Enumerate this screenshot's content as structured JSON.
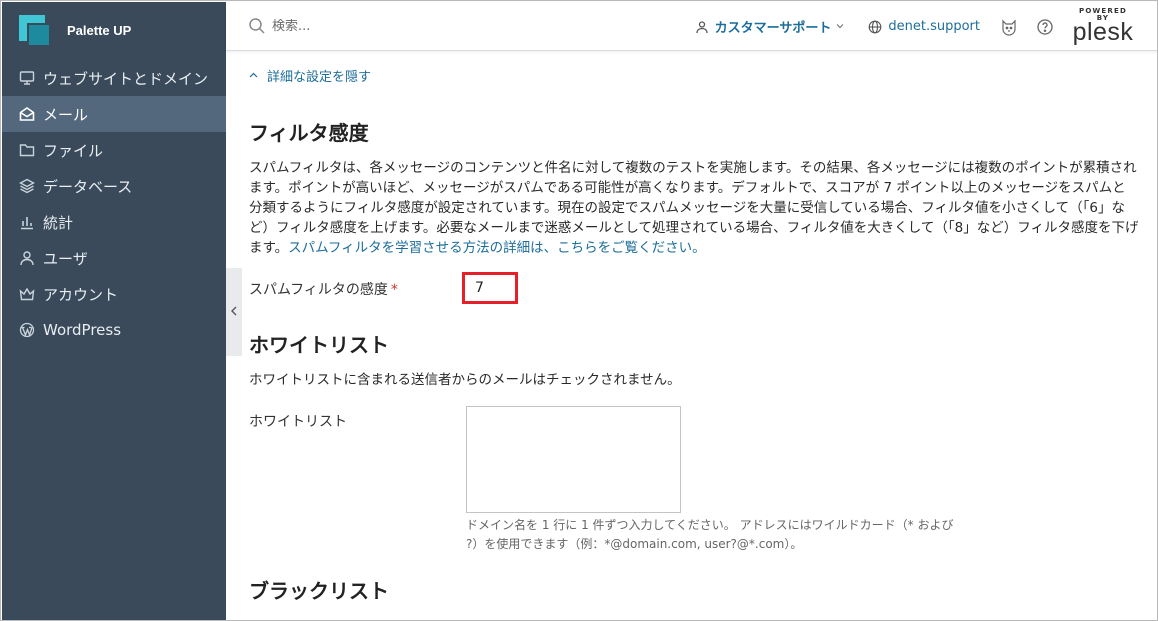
{
  "brand": {
    "name": "Palette UP"
  },
  "sidebar": {
    "items": [
      {
        "label": "ウェブサイトとドメイン",
        "icon": "monitor-icon",
        "active": false
      },
      {
        "label": "メール",
        "icon": "envelope-icon",
        "active": true
      },
      {
        "label": "ファイル",
        "icon": "folder-icon",
        "active": false
      },
      {
        "label": "データベース",
        "icon": "database-icon",
        "active": false
      },
      {
        "label": "統計",
        "icon": "bar-chart-icon",
        "active": false
      },
      {
        "label": "ユーザ",
        "icon": "user-icon",
        "active": false
      },
      {
        "label": "アカウント",
        "icon": "crown-icon",
        "active": false
      },
      {
        "label": "WordPress",
        "icon": "wordpress-icon",
        "active": false
      }
    ]
  },
  "header": {
    "search_placeholder": "検索...",
    "support_label": "カスタマーサポート",
    "domain_label": "denet.support",
    "powered_by": "POWERED BY",
    "plesk": "plesk"
  },
  "main": {
    "toggle_link": "詳細な設定を隠す",
    "filter": {
      "heading": "フィルタ感度",
      "description": "スパムフィルタは、各メッセージのコンテンツと件名に対して複数のテストを実施します。その結果、各メッセージには複数のポイントが累積されます。ポイントが高いほど、メッセージがスパムである可能性が高くなります。デフォルトで、スコアが 7 ポイント以上のメッセージをスパムと分類するようにフィルタ感度が設定されています。現在の設定でスパムメッセージを大量に受信している場合、フィルタ値を小さくして（「6」など）フィルタ感度を上げます。必要なメールまで迷惑メールとして処理されている場合、フィルタ値を大きくして（「8」など）フィルタ感度を下げます。",
      "link": "スパムフィルタを学習させる方法の詳細は、こちらをご覧ください。",
      "field_label": "スパムフィルタの感度",
      "required_mark": "*",
      "value": "7"
    },
    "whitelist": {
      "heading": "ホワイトリスト",
      "description": "ホワイトリストに含まれる送信者からのメールはチェックされません。",
      "field_label": "ホワイトリスト",
      "value": "",
      "hint": "ドメイン名を 1 行に 1 件ずつ入力してください。 アドレスにはワイルドカード（* および ?）を使用できます（例：*@domain.com, user?@*.com）。"
    },
    "blacklist": {
      "heading": "ブラックリスト"
    }
  }
}
